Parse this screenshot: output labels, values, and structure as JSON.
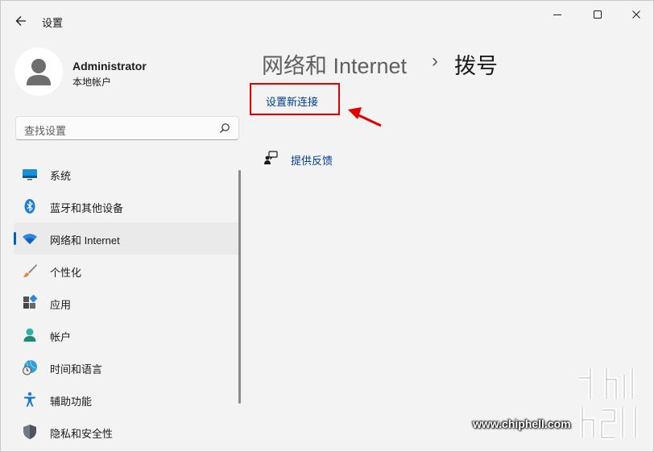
{
  "titlebar": {
    "app_title": "设置",
    "back_icon": "back-arrow-icon",
    "minimize_icon": "minimize-icon",
    "maximize_icon": "maximize-icon",
    "close_icon": "close-icon"
  },
  "profile": {
    "name": "Administrator",
    "account_type": "本地帐户"
  },
  "search": {
    "placeholder": "查找设置",
    "icon": "search-icon"
  },
  "sidebar": {
    "items": [
      {
        "label": "系统",
        "icon": "system-display-icon"
      },
      {
        "label": "蓝牙和其他设备",
        "icon": "bluetooth-icon"
      },
      {
        "label": "网络和 Internet",
        "icon": "wifi-icon",
        "selected": true
      },
      {
        "label": "个性化",
        "icon": "paintbrush-icon"
      },
      {
        "label": "应用",
        "icon": "apps-icon"
      },
      {
        "label": "帐户",
        "icon": "account-icon"
      },
      {
        "label": "时间和语言",
        "icon": "time-language-icon"
      },
      {
        "label": "辅助功能",
        "icon": "accessibility-icon"
      },
      {
        "label": "隐私和安全性",
        "icon": "shield-icon"
      }
    ]
  },
  "main": {
    "breadcrumb_parent": "网络和 Internet",
    "breadcrumb_separator": "›",
    "breadcrumb_current": "拨号",
    "new_connection_link": "设置新连接",
    "feedback_link": "提供反馈",
    "feedback_icon": "feedback-icon"
  },
  "watermark": {
    "url": "www.chiphell.com",
    "logo": "chiphell-logo"
  },
  "colors": {
    "accent": "#005fb8",
    "link": "#003e92",
    "highlight_box": "#e00000"
  }
}
